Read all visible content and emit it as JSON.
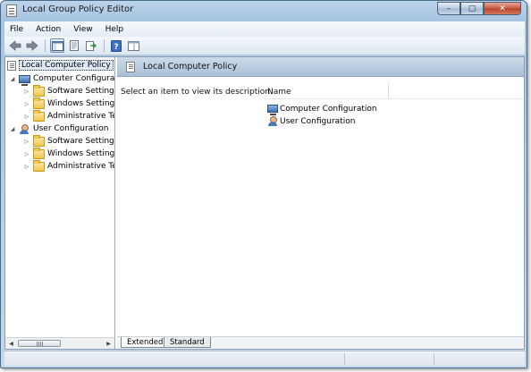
{
  "window": {
    "title": "Local Group Policy Editor",
    "caption_buttons": {
      "minimize": "–",
      "maximize": "▢",
      "close": "✕"
    }
  },
  "menubar": {
    "items": [
      "File",
      "Action",
      "View",
      "Help"
    ]
  },
  "toolbar": {
    "icons": [
      "back-arrow-icon",
      "forward-arrow-icon",
      "show-hide-tree-icon",
      "properties-icon",
      "export-list-icon",
      "help-icon",
      "extended-view-icon"
    ]
  },
  "tree": {
    "root": "Local Computer Policy",
    "computer": {
      "label": "Computer Configura",
      "children": [
        "Software Settings",
        "Windows Setting",
        "Administrative Te"
      ]
    },
    "user": {
      "label": "User Configuration",
      "children": [
        "Software Settings",
        "Windows Setting",
        "Administrative Te"
      ]
    }
  },
  "details": {
    "header_title": "Local Computer Policy",
    "description": "Select an item to view its description.",
    "column_name": "Name",
    "items": [
      "Computer Configuration",
      "User Configuration"
    ]
  },
  "tabs": {
    "extended": "Extended",
    "standard": "Standard"
  }
}
